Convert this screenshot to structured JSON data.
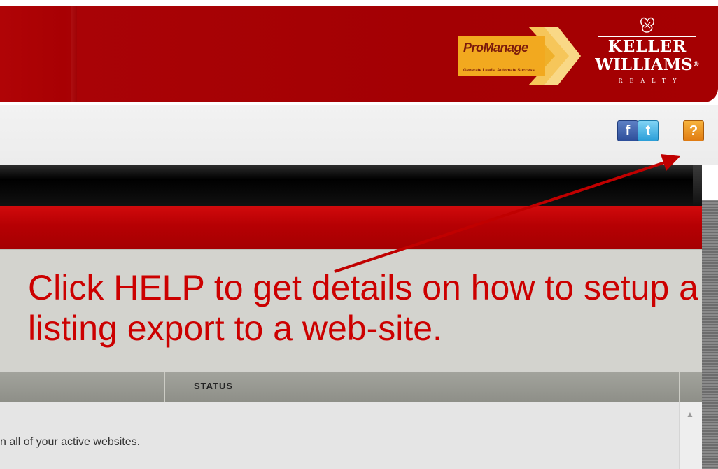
{
  "header": {
    "promanage_logo": {
      "title": "ProManage",
      "tagline": "Generate Leads. Automate Success."
    },
    "kw_logo": {
      "line1": "KELLER",
      "line2": "WILLIAMS",
      "registered": "®",
      "line3": "REALTY"
    },
    "colors": {
      "brand_red": "#a50002",
      "promanage_gold": "#f2a91f"
    }
  },
  "toolbar": {
    "facebook": {
      "icon": "facebook-icon",
      "glyph": "f"
    },
    "twitter": {
      "icon": "twitter-icon",
      "glyph": "t"
    },
    "help": {
      "icon": "help-icon",
      "glyph": "?"
    }
  },
  "table": {
    "columns": [
      "STATUS"
    ],
    "row_text": "n all of your active websites."
  },
  "annotation": {
    "text": "Click HELP to get details on how to setup a listing export to a web-site.",
    "color": "#cc0000"
  }
}
